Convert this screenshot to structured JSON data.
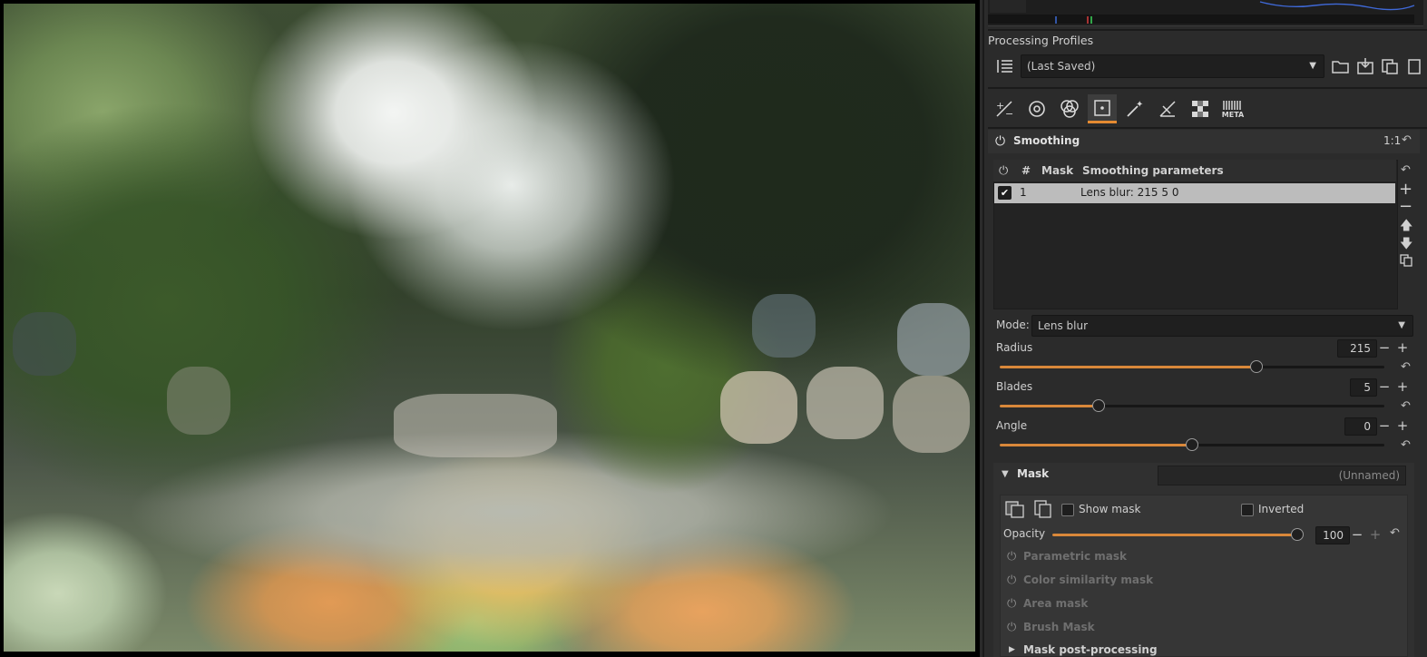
{
  "profiles": {
    "section_title": "Processing Profiles",
    "selected": "(Last Saved)"
  },
  "tabs": [
    {
      "name": "exposure-tab-icon",
      "glyph": "±"
    },
    {
      "name": "detail-tab-icon",
      "glyph": "◎"
    },
    {
      "name": "color-tab-icon",
      "glyph": "◉"
    },
    {
      "name": "local-adjustments-tab-icon",
      "glyph": "⊹"
    },
    {
      "name": "advanced-tab-icon",
      "glyph": "✧"
    },
    {
      "name": "transform-tab-icon",
      "glyph": "⟋"
    },
    {
      "name": "raw-tab-icon",
      "glyph": "▦"
    },
    {
      "name": "meta-tab-icon",
      "glyph": "META"
    }
  ],
  "smoothing": {
    "title": "Smoothing",
    "zoom_hint": "1:1",
    "table": {
      "headers": [
        "#",
        "Mask",
        "Smoothing parameters"
      ],
      "rows": [
        {
          "index": "1",
          "mask": "",
          "params": "Lens blur: 215 5 0",
          "checked": true
        }
      ]
    },
    "mode_label": "Mode:",
    "mode_value": "Lens blur",
    "radius": {
      "label": "Radius",
      "value": "215",
      "fraction": 0.665
    },
    "blades": {
      "label": "Blades",
      "value": "5",
      "fraction": 0.25
    },
    "angle": {
      "label": "Angle",
      "value": "0",
      "fraction": 0.5
    }
  },
  "mask": {
    "title": "Mask",
    "name_value": "(Unnamed)",
    "show_mask_label": "Show mask",
    "inverted_label": "Inverted",
    "opacity_label": "Opacity",
    "opacity_value": "100",
    "opacity_fraction": 1.0,
    "sub_masks": [
      "Parametric mask",
      "Color similarity mask",
      "Area mask",
      "Brush Mask"
    ],
    "post_processing": "Mask post-processing"
  },
  "colors": {
    "accent": "#d9883a",
    "panel_bg": "#2b2b2b",
    "selected_row": "#bcbcbc"
  }
}
